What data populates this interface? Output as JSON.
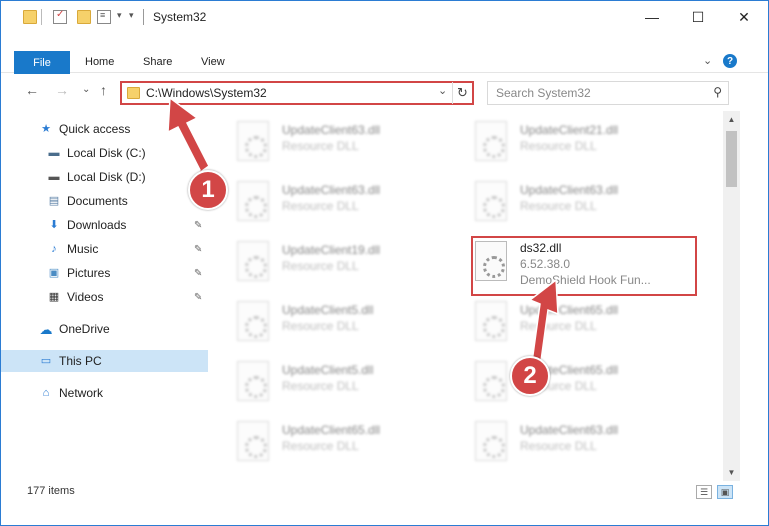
{
  "window": {
    "title": "System32",
    "controls": {
      "minimize": "—",
      "maximize": "☐",
      "close": "✕"
    }
  },
  "ribbon": {
    "file_tab": "File",
    "tabs": [
      "Home",
      "Share",
      "View"
    ],
    "expand": "⌄",
    "help": "?"
  },
  "nav": {
    "back": "←",
    "forward": "→",
    "recent": "⌄",
    "up": "↑",
    "address": "C:\\Windows\\System32",
    "address_dropdown": "⌄",
    "refresh": "↻",
    "search_placeholder": "Search System32",
    "search_icon": "⚲"
  },
  "sidebar": {
    "items": [
      {
        "label": "Quick access",
        "icon": "★",
        "icon_color": "#2b7cd3",
        "pinned": false
      },
      {
        "label": "Local Disk (C:)",
        "icon": "▬",
        "icon_color": "#4a6d8c",
        "pinned": false
      },
      {
        "label": "Local Disk (D:)",
        "icon": "▬",
        "icon_color": "#555555",
        "pinned": false
      },
      {
        "label": "Documents",
        "icon": "▤",
        "icon_color": "#5a7fa6",
        "pinned": true
      },
      {
        "label": "Downloads",
        "icon": "⬇",
        "icon_color": "#2b7cd3",
        "pinned": true
      },
      {
        "label": "Music",
        "icon": "♪",
        "icon_color": "#2b7cd3",
        "pinned": true
      },
      {
        "label": "Pictures",
        "icon": "▣",
        "icon_color": "#4a8cc4",
        "pinned": true
      },
      {
        "label": "Videos",
        "icon": "▦",
        "icon_color": "#333333",
        "pinned": true
      },
      {
        "label": "OneDrive",
        "icon": "☁",
        "icon_color": "#1979ca",
        "pinned": false
      },
      {
        "label": "This PC",
        "icon": "▭",
        "icon_color": "#2b7cd3",
        "pinned": false,
        "selected": true
      },
      {
        "label": "Network",
        "icon": "⌂",
        "icon_color": "#2b7cd3",
        "pinned": false
      }
    ],
    "pin_glyph": "📌"
  },
  "files": {
    "blurred": [
      {
        "name": "UpdateClient63.dll",
        "type": "Resource DLL"
      },
      {
        "name": "UpdateClient21.dll",
        "type": "Resource DLL"
      },
      {
        "name": "UpdateClient63.dll",
        "type": "Resource DLL"
      },
      {
        "name": "UpdateClient63.dll",
        "type": "Resource DLL"
      },
      {
        "name": "UpdateClient19.dll",
        "type": "Resource DLL"
      },
      {
        "name": "UpdateClient5.dll",
        "type": "Resource DLL"
      },
      {
        "name": "UpdateClient65.dll",
        "type": "Resource DLL"
      },
      {
        "name": "UpdateClient5.dll",
        "type": "Resource DLL"
      },
      {
        "name": "UpdateClient65.dll",
        "type": "Resource DLL"
      },
      {
        "name": "UpdateClient65.dll",
        "type": "Resource DLL"
      },
      {
        "name": "UpdateClient63.dll",
        "type": "Resource DLL"
      }
    ],
    "focused": {
      "name": "ds32.dll",
      "version": "6.52.38.0",
      "description": "DemoShield Hook Fun..."
    }
  },
  "status": {
    "item_count": "177 items"
  },
  "annotations": {
    "step1": "1",
    "step2": "2",
    "color": "#d24646"
  }
}
